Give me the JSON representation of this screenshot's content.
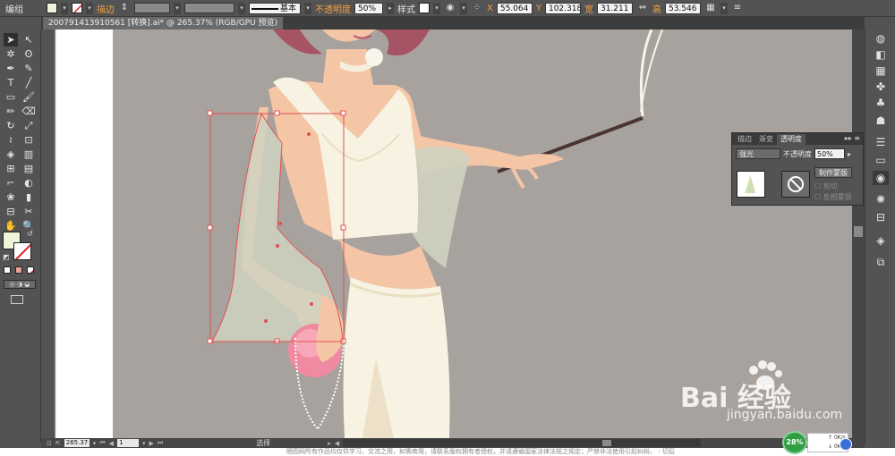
{
  "control_bar": {
    "mode_label": "编组",
    "stroke_label": "描边",
    "stroke_style": "基本",
    "opacity_label": "不透明度",
    "opacity_value": "50%",
    "style_label": "样式",
    "x_label": "X",
    "x_value": "55.064 mm",
    "y_label": "Y",
    "y_value": "102.318 m",
    "w_label": "宽",
    "w_value": "31.211 mm",
    "h_label": "高",
    "h_value": "53.546 mm",
    "fill_color": "#eef5d9",
    "accent_color": "#f0a040"
  },
  "document": {
    "tab_title": "200791413910561 [转换].ai* @ 265.37% (RGB/GPU 预览)"
  },
  "transparency_panel": {
    "tabs": [
      "描边",
      "渐变",
      "透明度"
    ],
    "active_tab": "透明度",
    "blend_mode": "强光",
    "opacity_label": "不透明度",
    "opacity_value": "50%",
    "make_mask_label": "制作蒙版",
    "clip_label": "剪切",
    "invert_label": "反相蒙版"
  },
  "status_bar": {
    "zoom_value": "265.37",
    "page_value": "1",
    "tool_status": "选择"
  },
  "caption": "晒图网所有作品均仅供学习、交流之用，如需商用，请联系版权拥有者授权，并请遵循国家法律法规之规定；严禁非法使用引起纠纷。 - 切后",
  "watermark": {
    "brand": "Bai 经验",
    "url": "jingyan.baidu.com"
  },
  "speed_widget": {
    "percent": "28%",
    "up": "0K/s",
    "down": "0K/s"
  },
  "colors": {
    "canvas_bg": "#a8a29e",
    "selection": "#e05050",
    "sleeve": "#cfd2c0"
  }
}
